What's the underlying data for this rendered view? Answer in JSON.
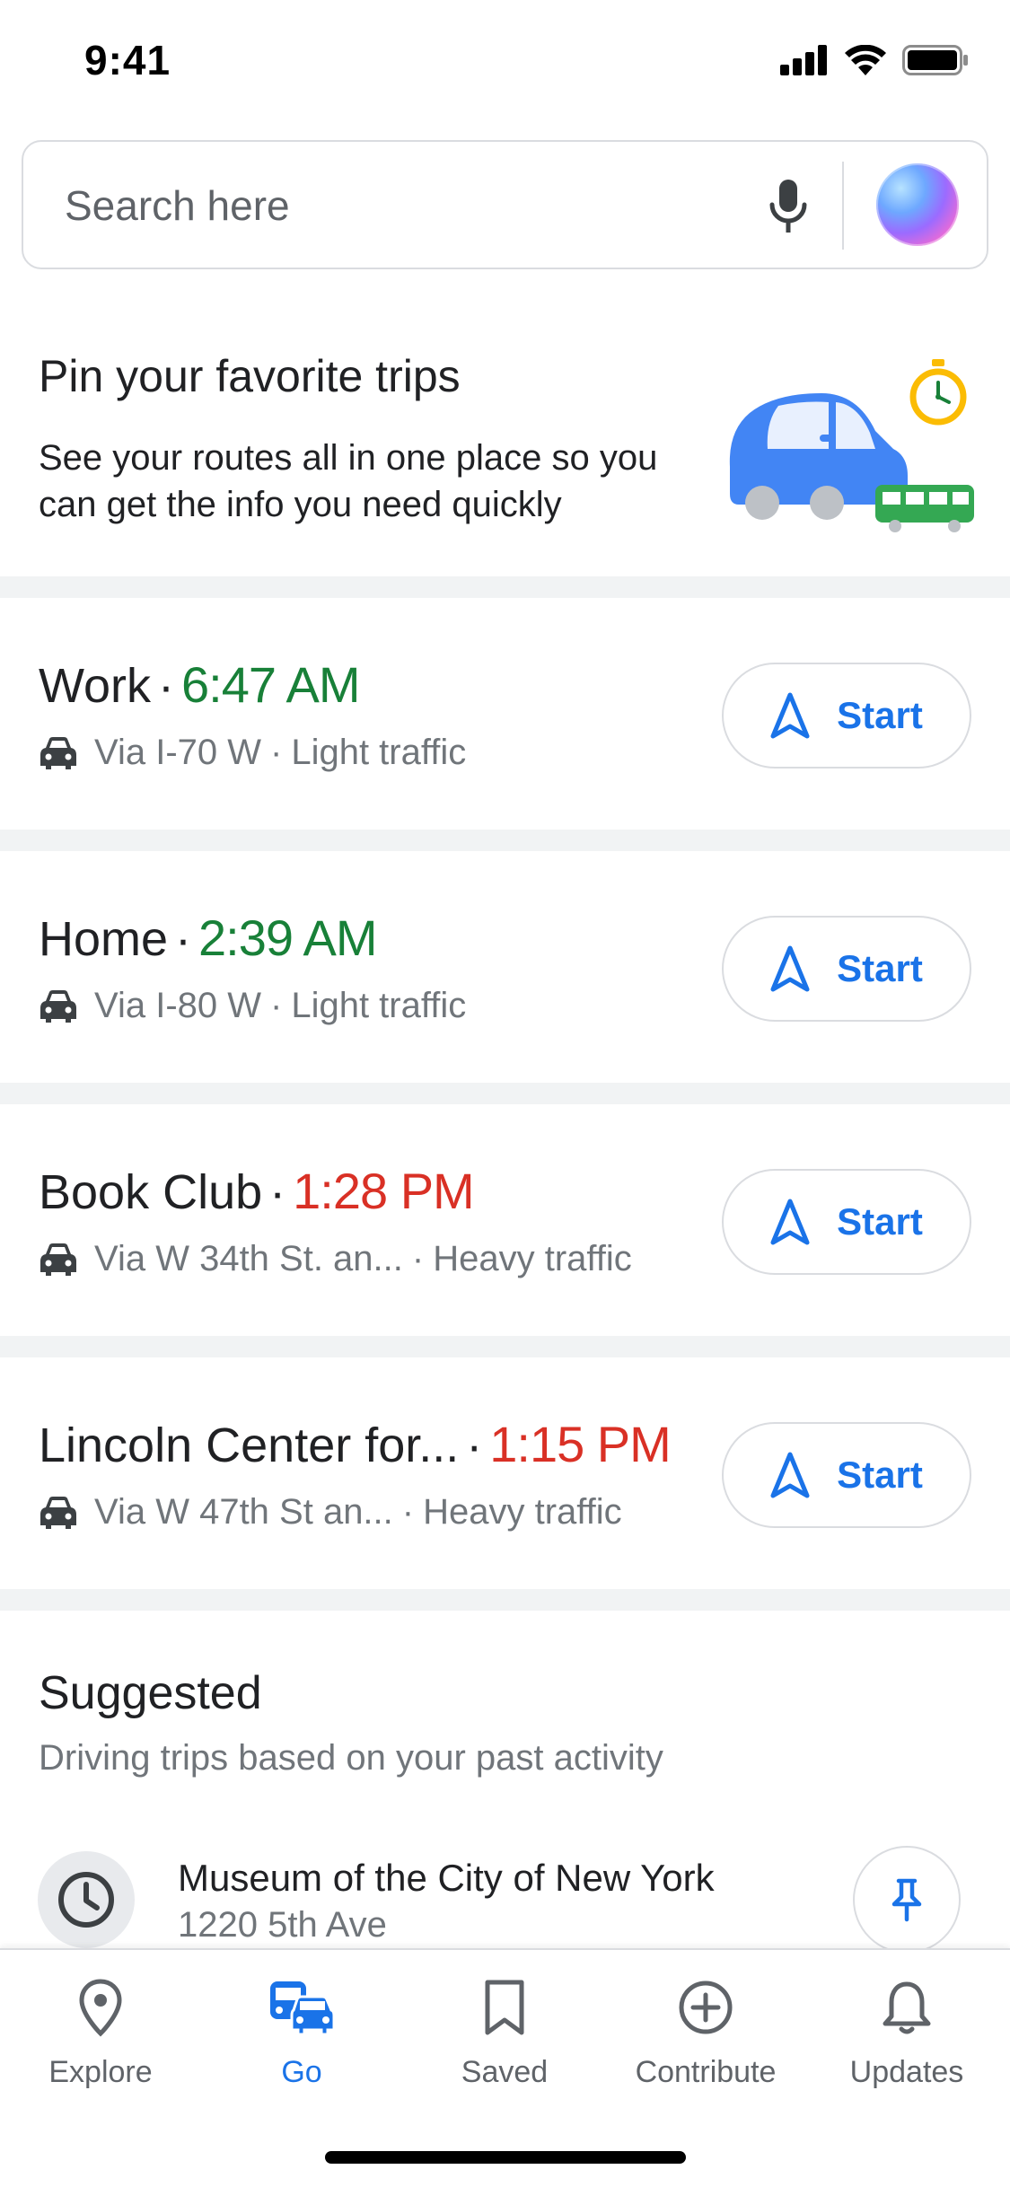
{
  "status_bar": {
    "time": "9:41"
  },
  "search": {
    "placeholder": "Search here"
  },
  "promo": {
    "title": "Pin your favorite trips",
    "description": "See your routes all in one place so you can get the info you need quickly"
  },
  "trips": [
    {
      "name": "Work",
      "time": "6:47 AM",
      "time_status": "on-time",
      "route": "Via I-70 W",
      "traffic": "Light traffic",
      "button": "Start"
    },
    {
      "name": "Home",
      "time": "2:39 AM",
      "time_status": "on-time",
      "route": "Via I-80 W",
      "traffic": "Light traffic",
      "button": "Start"
    },
    {
      "name": "Book Club",
      "time": "1:28 PM",
      "time_status": "delayed",
      "route": "Via W 34th St. an...",
      "traffic": "Heavy traffic",
      "button": "Start"
    },
    {
      "name": "Lincoln Center for...",
      "time": "1:15 PM",
      "time_status": "delayed",
      "route": "Via W 47th St an...",
      "traffic": "Heavy traffic",
      "button": "Start"
    }
  ],
  "suggested": {
    "title": "Suggested",
    "subtitle": "Driving trips based on your past activity",
    "items": [
      {
        "name": "Museum of the City of New York",
        "address": "1220 5th Ave",
        "icon": "clock-icon"
      }
    ]
  },
  "bottom_nav": [
    {
      "label": "Explore",
      "icon": "location-pin-icon",
      "active": false
    },
    {
      "label": "Go",
      "icon": "commute-icon",
      "active": true
    },
    {
      "label": "Saved",
      "icon": "bookmark-icon",
      "active": false
    },
    {
      "label": "Contribute",
      "icon": "add-circle-icon",
      "active": false
    },
    {
      "label": "Updates",
      "icon": "bell-icon",
      "active": false
    }
  ],
  "colors": {
    "accent_blue": "#1a73e8",
    "on_time_green": "#188038",
    "delayed_red": "#d93025",
    "secondary_text": "#70757a",
    "divider": "#f1f3f4"
  }
}
